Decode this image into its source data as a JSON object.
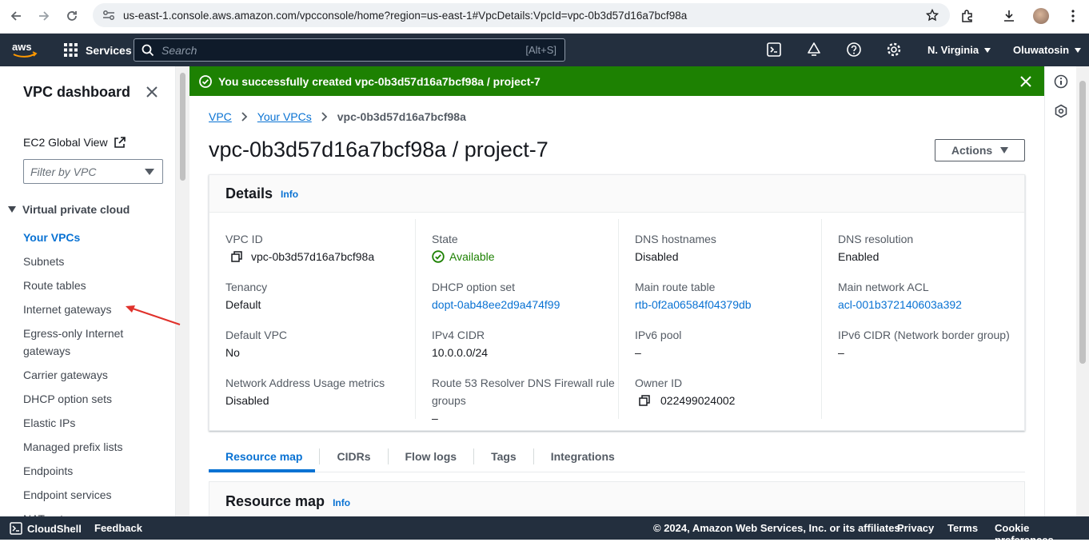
{
  "browser": {
    "url": "us-east-1.console.aws.amazon.com/vpcconsole/home?region=us-east-1#VpcDetails:VpcId=vpc-0b3d57d16a7bcf98a"
  },
  "topnav": {
    "services_label": "Services",
    "search_placeholder": "Search",
    "search_shortcut": "[Alt+S]",
    "region": "N. Virginia",
    "user": "Oluwatosin"
  },
  "sidebar": {
    "title": "VPC dashboard",
    "global_view": "EC2 Global View",
    "filter_placeholder": "Filter by VPC",
    "section": "Virtual private cloud",
    "items": [
      {
        "label": "Your VPCs",
        "active": true
      },
      {
        "label": "Subnets"
      },
      {
        "label": "Route tables"
      },
      {
        "label": "Internet gateways"
      },
      {
        "label": "Egress-only Internet gateways"
      },
      {
        "label": "Carrier gateways"
      },
      {
        "label": "DHCP option sets"
      },
      {
        "label": "Elastic IPs"
      },
      {
        "label": "Managed prefix lists"
      },
      {
        "label": "Endpoints"
      },
      {
        "label": "Endpoint services"
      },
      {
        "label": "NAT gateways"
      }
    ]
  },
  "flash": {
    "message": "You successfully created vpc-0b3d57d16a7bcf98a / project-7",
    "color": "#1d8102"
  },
  "breadcrumb": [
    "VPC",
    "Your VPCs",
    "vpc-0b3d57d16a7bcf98a"
  ],
  "page": {
    "title": "vpc-0b3d57d16a7bcf98a / project-7",
    "actions_label": "Actions"
  },
  "details": {
    "title": "Details",
    "info": "Info",
    "columns": [
      [
        {
          "key": "VPC ID",
          "value": "vpc-0b3d57d16a7bcf98a",
          "copy": true
        },
        {
          "key": "Tenancy",
          "value": "Default"
        },
        {
          "key": "Default VPC",
          "value": "No"
        },
        {
          "key": "Network Address Usage metrics",
          "value": "Disabled"
        }
      ],
      [
        {
          "key": "State",
          "value": "Available",
          "status": "ok"
        },
        {
          "key": "DHCP option set",
          "value": "dopt-0ab48ee2d9a474f99",
          "link": true
        },
        {
          "key": "IPv4 CIDR",
          "value": "10.0.0.0/24"
        },
        {
          "key": "Route 53 Resolver DNS Firewall rule groups",
          "value": "–"
        }
      ],
      [
        {
          "key": "DNS hostnames",
          "value": "Disabled"
        },
        {
          "key": "Main route table",
          "value": "rtb-0f2a06584f04379db",
          "link": true
        },
        {
          "key": "IPv6 pool",
          "value": "–"
        },
        {
          "key": "Owner ID",
          "value": "022499024002",
          "copy": true
        }
      ],
      [
        {
          "key": "DNS resolution",
          "value": "Enabled"
        },
        {
          "key": "Main network ACL",
          "value": "acl-001b372140603a392",
          "link": true
        },
        {
          "key": "IPv6 CIDR (Network border group)",
          "value": "–"
        }
      ]
    ]
  },
  "tabs": [
    "Resource map",
    "CIDRs",
    "Flow logs",
    "Tags",
    "Integrations"
  ],
  "resource_map": {
    "title": "Resource map",
    "info": "Info"
  },
  "footer": {
    "cloudshell": "CloudShell",
    "feedback": "Feedback",
    "copyright": "© 2024, Amazon Web Services, Inc. or its affiliates.",
    "privacy": "Privacy",
    "terms": "Terms",
    "cookies": "Cookie preferences"
  },
  "colors": {
    "aws_nav": "#232f3e",
    "link": "#0972d3",
    "success": "#1d8102",
    "annotation_arrow": "#e0312b"
  }
}
